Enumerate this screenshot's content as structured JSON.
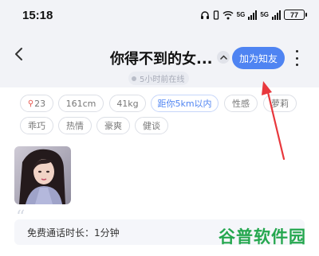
{
  "status_bar": {
    "time": "15:18",
    "battery": "77",
    "net1": "5G",
    "net2": "5G"
  },
  "header": {
    "title": "你得不到的女...",
    "add_friend": "加为知友",
    "online_status": "5小时前在线"
  },
  "tags": [
    {
      "label": "23",
      "icon": "female-pin-icon"
    },
    {
      "label": "161cm"
    },
    {
      "label": "41kg"
    },
    {
      "label": "距你5km以内",
      "highlight": true
    },
    {
      "label": "性感"
    },
    {
      "label": "萝莉"
    },
    {
      "label": "乖巧"
    },
    {
      "label": "热情"
    },
    {
      "label": "豪爽"
    },
    {
      "label": "健谈"
    }
  ],
  "call_info": "免费通话时长：1分钟",
  "watermark": "谷普软件园",
  "colors": {
    "accent": "#4f84f2",
    "arrow": "#e8383d",
    "watermark": "#25a74f"
  }
}
